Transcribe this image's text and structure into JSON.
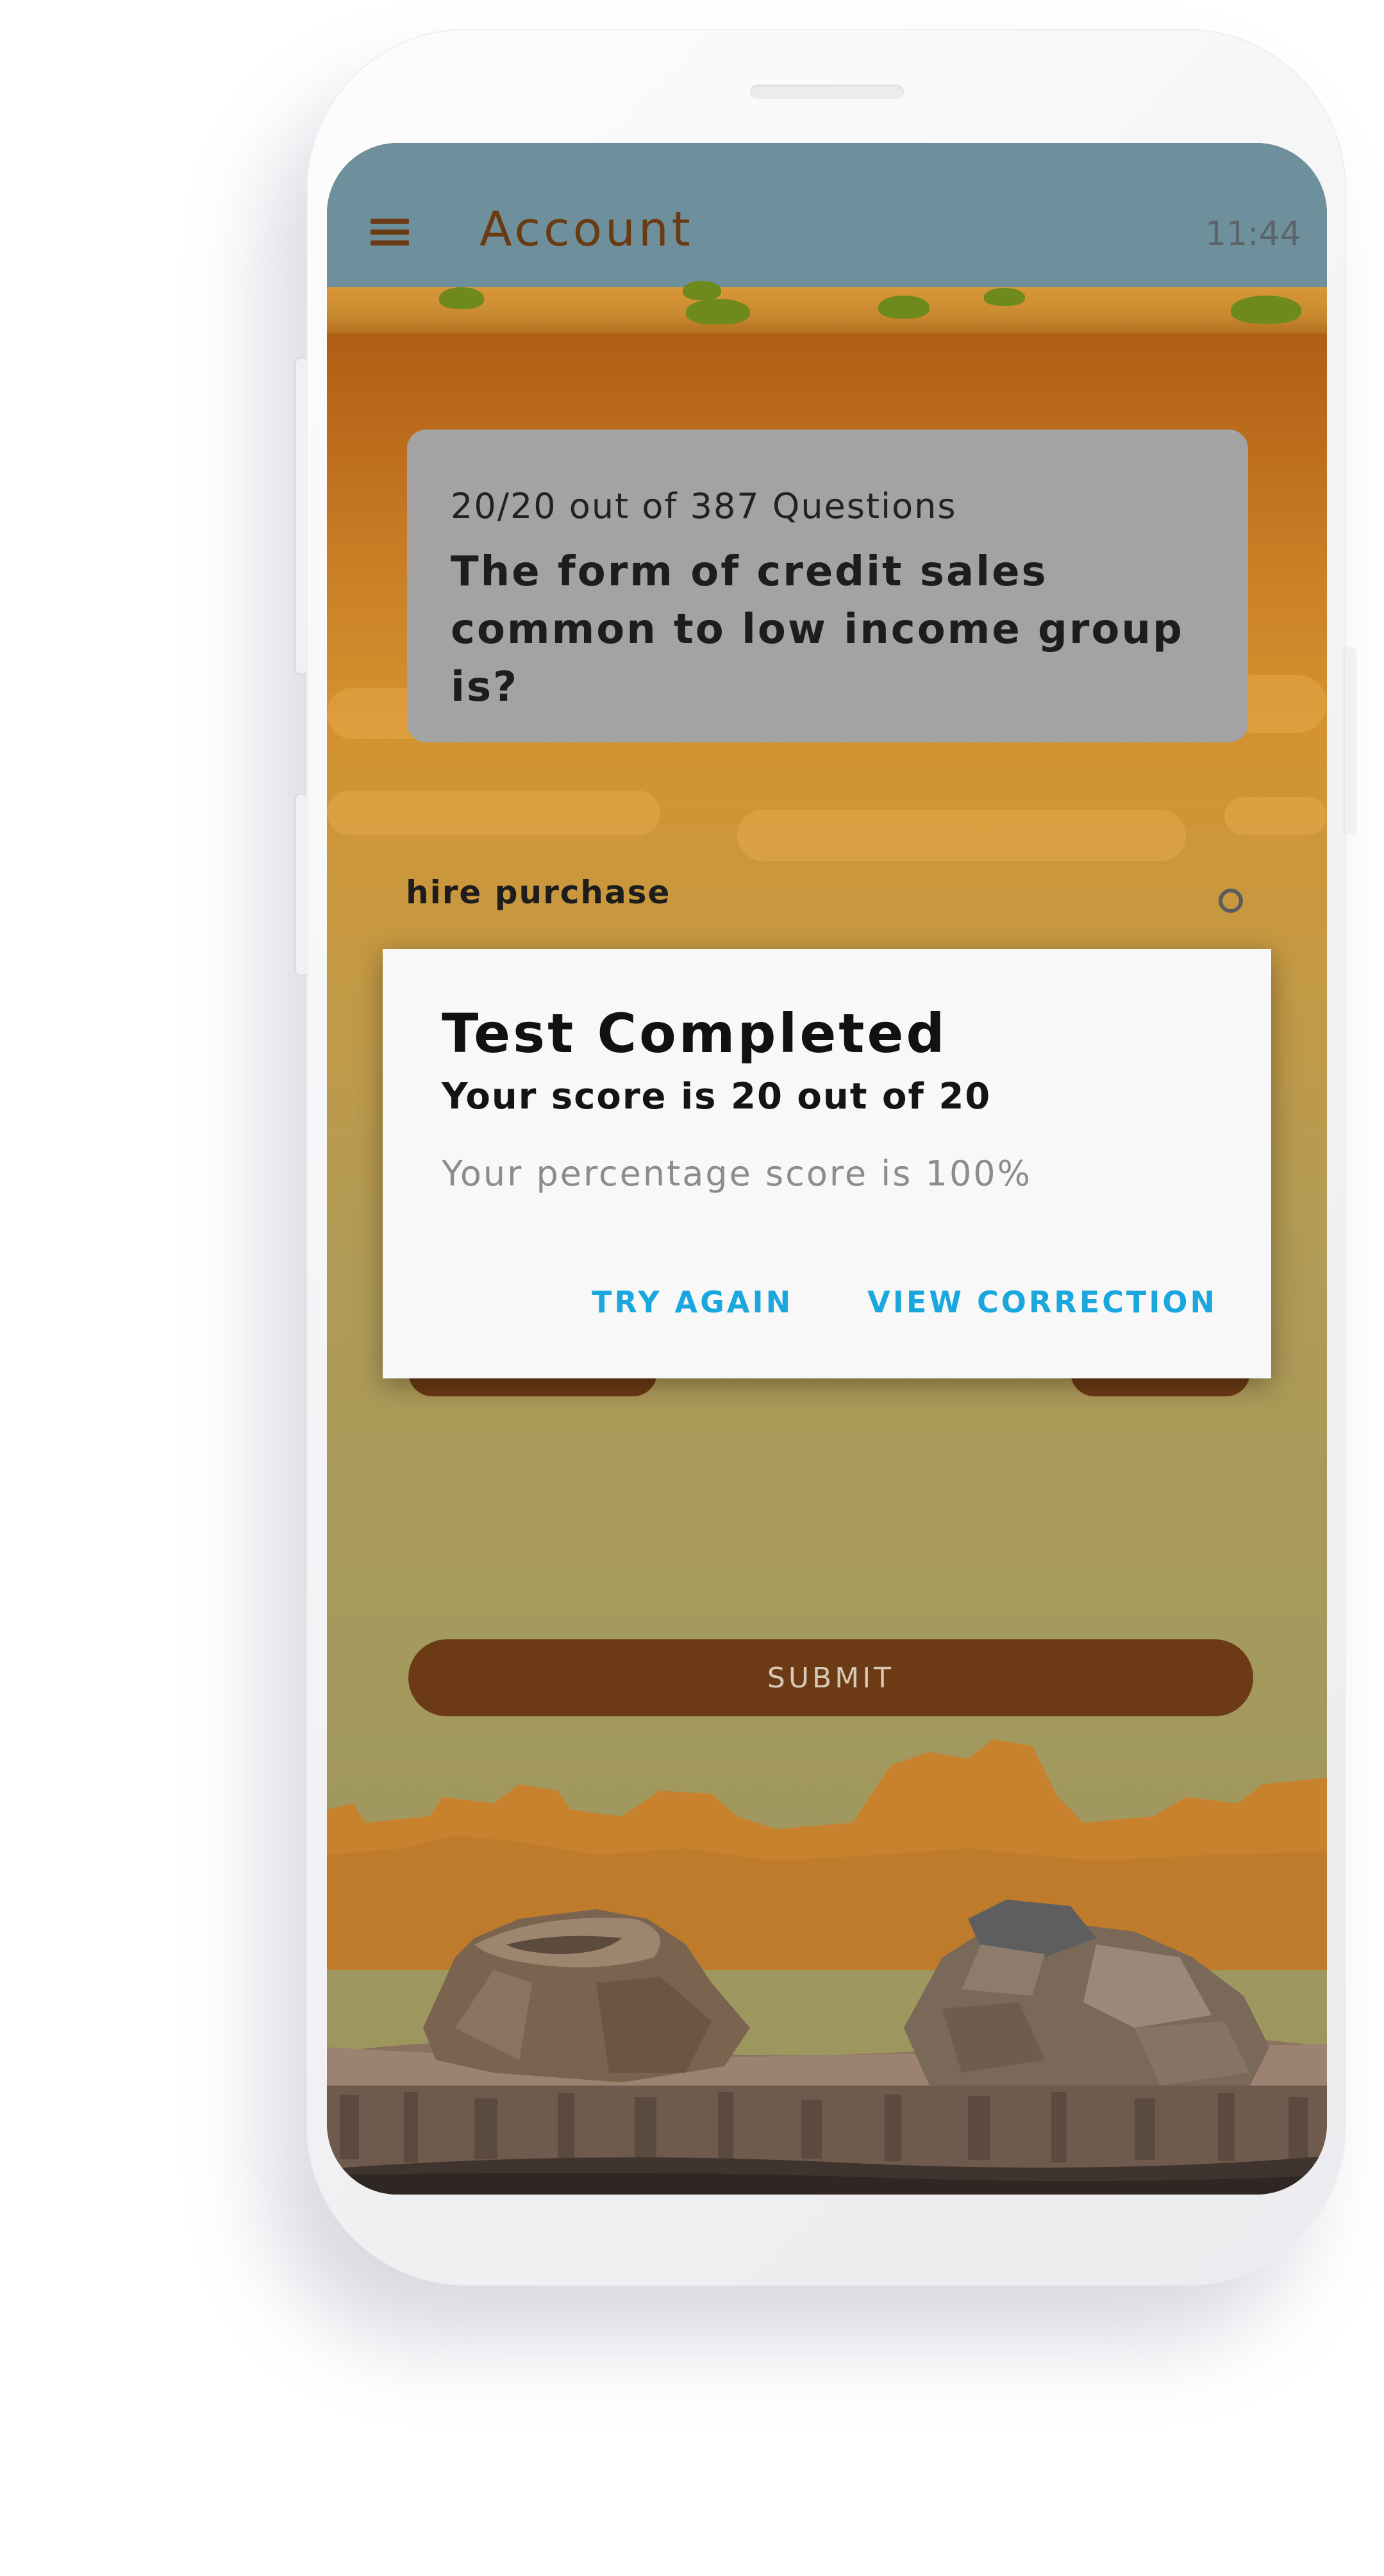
{
  "header": {
    "menu_icon": "hamburger-menu-icon",
    "title": "Account",
    "time": "11:44"
  },
  "question": {
    "progress": "20/20 out of 387 Questions",
    "text": "The form of credit sales common to low income group is?"
  },
  "option": {
    "label": "hire purchase",
    "selected": false
  },
  "submit": {
    "label": "SUBMIT"
  },
  "dialog": {
    "title": "Test Completed",
    "score": "Your score is 20 out of 20",
    "percentage": "Your percentage score is 100%",
    "try_again_label": "TRY AGAIN",
    "view_correction_label": "VIEW CORRECTION"
  },
  "colors": {
    "accent": "#19a7dd",
    "brown": "#6c3a15",
    "sky": "#6e909c"
  }
}
